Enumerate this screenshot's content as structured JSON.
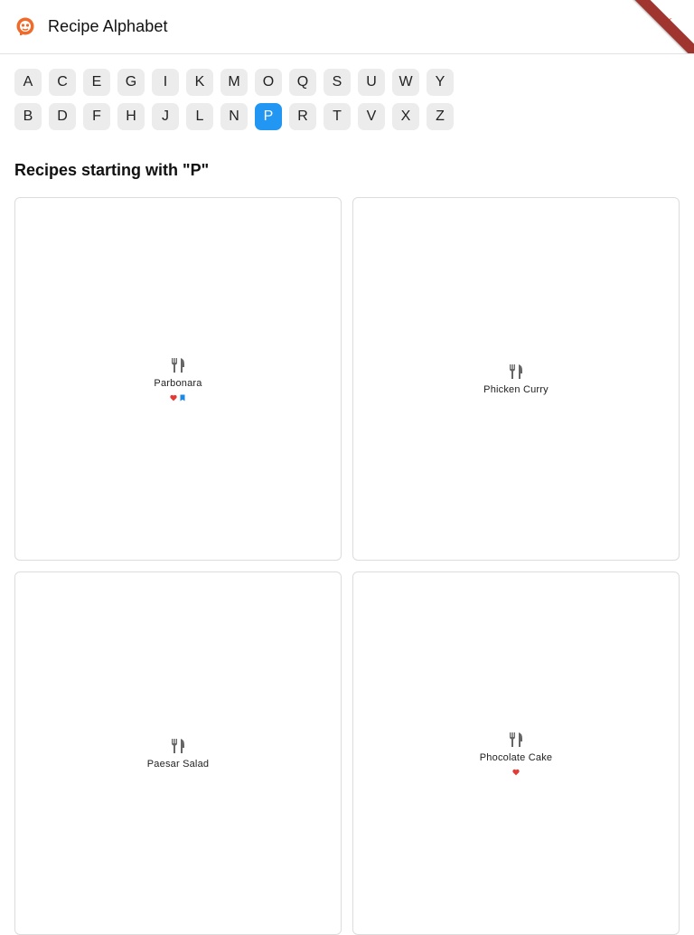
{
  "app": {
    "title": "Recipe Alphabet",
    "accent": "#f06a2a",
    "banner_color": "#a0352f"
  },
  "letters": {
    "row1": [
      "A",
      "C",
      "E",
      "G",
      "I",
      "K",
      "M",
      "O",
      "Q",
      "S",
      "U",
      "W",
      "Y"
    ],
    "row2": [
      "B",
      "D",
      "F",
      "H",
      "J",
      "L",
      "N",
      "P",
      "R",
      "T",
      "V",
      "X",
      "Z"
    ],
    "selected": "P",
    "selected_color": "#2196f3"
  },
  "section": {
    "title": "Recipes starting with \"P\""
  },
  "recipes": [
    {
      "name": "Parbonara",
      "icon": "fork-knife-icon",
      "favorite": true,
      "bookmarked": true
    },
    {
      "name": "Phicken Curry",
      "icon": "fork-knife-icon",
      "favorite": false,
      "bookmarked": false
    },
    {
      "name": "Paesar Salad",
      "icon": "fork-knife-icon",
      "favorite": false,
      "bookmarked": false
    },
    {
      "name": "Phocolate Cake",
      "icon": "fork-knife-icon",
      "favorite": true,
      "bookmarked": false
    }
  ]
}
